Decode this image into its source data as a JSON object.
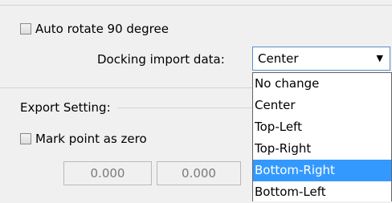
{
  "auto_rotate": {
    "label": "Auto rotate 90 degree",
    "checked": false
  },
  "docking": {
    "label": "Docking import data:",
    "selected": "Center",
    "arrow_icon": "dropdown-arrow-icon",
    "options": [
      "No change",
      "Center",
      "Top-Left",
      "Top-Right",
      "Bottom-Right",
      "Bottom-Left"
    ],
    "highlighted_option": "Bottom-Right"
  },
  "export": {
    "group_label": "Export Setting:",
    "mark_point": {
      "label": "Mark point as zero",
      "checked": false
    },
    "x_value": "0.000",
    "y_value": "0.000"
  },
  "colors": {
    "highlight": "#3399ff",
    "focus_border": "#5b8dc9"
  }
}
